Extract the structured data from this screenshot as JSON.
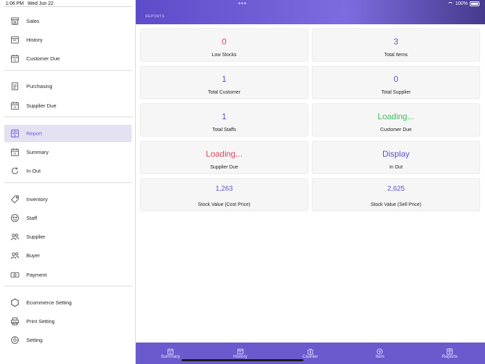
{
  "status_bar": {
    "time": "1:06 PM",
    "date": "Wed Jun 22",
    "battery": "100%"
  },
  "header": {
    "title": "REPORTS"
  },
  "sidebar": {
    "groups": [
      [
        {
          "label": "Sales",
          "icon": "store-icon",
          "active": false
        },
        {
          "label": "History",
          "icon": "history-icon",
          "active": false
        },
        {
          "label": "Customer Due",
          "icon": "calendar-icon",
          "active": false
        }
      ],
      [
        {
          "label": "Purchasing",
          "icon": "document-icon",
          "active": false
        },
        {
          "label": "Supplier Due",
          "icon": "calendar-icon",
          "active": false
        }
      ],
      [
        {
          "label": "Report",
          "icon": "report-icon",
          "active": true
        },
        {
          "label": "Summary",
          "icon": "calendar-icon",
          "active": false
        },
        {
          "label": "In Out",
          "icon": "refresh-icon",
          "active": false
        }
      ],
      [
        {
          "label": "Inventory",
          "icon": "tag-icon",
          "active": false
        },
        {
          "label": "Staff",
          "icon": "staff-icon",
          "active": false
        },
        {
          "label": "Supplier",
          "icon": "users-icon",
          "active": false
        },
        {
          "label": "Buyer",
          "icon": "users-icon",
          "active": false
        },
        {
          "label": "Payment",
          "icon": "money-icon",
          "active": false
        }
      ],
      [
        {
          "label": "Ecommerce Setting",
          "icon": "hexagon-icon",
          "active": false
        },
        {
          "label": "Print Setting",
          "icon": "printer-icon",
          "active": false
        },
        {
          "label": "Setting",
          "icon": "gear-icon",
          "active": false
        }
      ]
    ]
  },
  "cards": [
    {
      "value": "0",
      "label": "Low Stocks",
      "color": "#d9455f"
    },
    {
      "value": "3",
      "label": "Total Items",
      "color": "#5a53c8"
    },
    {
      "value": "1",
      "label": "Total Customer",
      "color": "#5a53c8"
    },
    {
      "value": "0",
      "label": "Total Supplier",
      "color": "#5a53c8"
    },
    {
      "value": "1",
      "label": "Total Staffs",
      "color": "#5a53c8"
    },
    {
      "value": "Loading...",
      "label": "Customer Due",
      "color": "#3ebd5c"
    },
    {
      "value": "Loading...",
      "label": "Supplier Due",
      "color": "#d9455f"
    },
    {
      "value": "Display",
      "label": "In Out",
      "color": "#5a53c8"
    },
    {
      "value": "1,263",
      "label": "Stock Value (Cost Price)",
      "color": "#5a53c8"
    },
    {
      "value": "2,625",
      "label": "Stock Value (Sell Price)",
      "color": "#5a53c8"
    }
  ],
  "tabs": [
    {
      "label": "Summary",
      "icon": "calendar-icon"
    },
    {
      "label": "History",
      "icon": "history-icon"
    },
    {
      "label": "Cashier",
      "icon": "cashier-icon"
    },
    {
      "label": "Item",
      "icon": "add-circle-icon"
    },
    {
      "label": "Reports",
      "icon": "report-icon"
    }
  ]
}
